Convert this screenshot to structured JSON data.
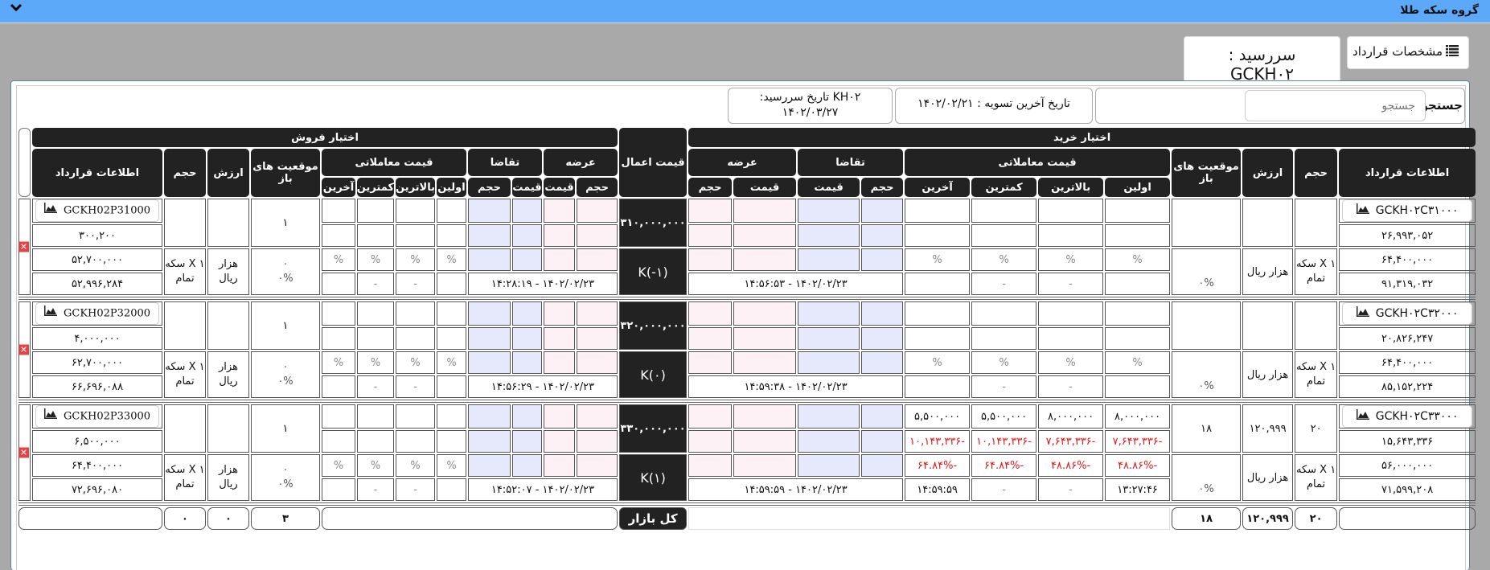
{
  "topbar": {
    "title": "گروه سکه طلا",
    "chevron_icon": "chevron-down-icon"
  },
  "tabs": {
    "spec_label": "مشخصات قرارداد",
    "spec_icon": "list-icon",
    "maturity_label": "سررسید : GCKH۰۲"
  },
  "info": {
    "search_label": "جستجو",
    "search_placeholder": "جستجو",
    "search_value": "",
    "last_settlement": "تاریخ آخرین تسویه : ۱۴۰۲/۰۲/۲۱",
    "maturity_line1": "KH۰۲ تاریخ سررسید:",
    "maturity_line2": "۱۴۰۲/۰۳/۲۷"
  },
  "headers": {
    "put_group": "اختیار فروش",
    "call_group": "اختیار خرید",
    "exercise_price": "قیمت اعمال",
    "contract_info": "اطلاعات قرارداد",
    "volume": "حجم",
    "value": "ارزش",
    "open_positions": "موقعیت های باز",
    "trade_price": "قیمت معاملاتی",
    "bid": "تقاضا",
    "ask": "عرضه",
    "first": "اولین",
    "high": "بالاترین",
    "low": "کمترین",
    "last": "آخرین",
    "qty": "حجم",
    "price": "قیمت",
    "total_market": "کل بازار"
  },
  "rows": [
    {
      "strike": "۳۱۰,۰۰۰,۰۰۰",
      "k": "K(-۱)",
      "put": {
        "symbol": "GCKH02P31000",
        "price1": "۳۰۰,۲۰۰",
        "price2": "۵۲,۷۰۰,۰۰۰",
        "price3": "۵۲,۹۹۶,۲۸۴",
        "unit": "X ۱ سکه تمام",
        "value_unit": "هزار ریال",
        "open_pos": "۱",
        "open_pos_change": "۰",
        "open_pos_pct": "۰%",
        "volume": "",
        "value": "",
        "trade": {
          "first": "",
          "high": "",
          "low": "",
          "last": ""
        },
        "trade_change": {
          "first": "",
          "high": "",
          "low": "",
          "last": ""
        },
        "trade_pct": {
          "first": "%",
          "high": "%",
          "low": "%",
          "last": "%"
        },
        "trade_time": {
          "first": "",
          "high": "-",
          "low": "-",
          "last": ""
        },
        "quote_time": "۱۴۰۲/۰۲/۲۳ - ۱۴:۲۸:۱۹"
      },
      "call": {
        "symbol": "GCKH۰۲C۳۱۰۰۰",
        "price1": "۲۶,۹۹۳,۰۵۲",
        "price2": "۶۴,۴۰۰,۰۰۰",
        "price3": "۹۱,۳۱۹,۰۳۲",
        "unit": "X ۱ سکه تمام",
        "value_unit": "هزار ریال",
        "open_pos": "",
        "open_pos_pct": "۰%",
        "volume": "",
        "value": "",
        "trade": {
          "first": "",
          "high": "",
          "low": "",
          "last": ""
        },
        "trade_change": {
          "first": "",
          "high": "",
          "low": "",
          "last": ""
        },
        "trade_pct": {
          "first": "%",
          "high": "%",
          "low": "%",
          "last": "%"
        },
        "trade_time": {
          "first": "",
          "high": "-",
          "low": "-",
          "last": ""
        },
        "quote_time": "۱۴۰۲/۰۲/۲۳ - ۱۴:۵۶:۵۳"
      }
    },
    {
      "strike": "۳۲۰,۰۰۰,۰۰۰",
      "k": "K(۰)",
      "put": {
        "symbol": "GCKH02P32000",
        "price1": "۴,۰۰۰,۰۰۰",
        "price2": "۶۲,۷۰۰,۰۰۰",
        "price3": "۶۶,۶۹۶,۰۸۸",
        "unit": "X ۱ سکه تمام",
        "value_unit": "هزار ریال",
        "open_pos": "۱",
        "open_pos_change": "۰",
        "open_pos_pct": "۰%",
        "volume": "",
        "value": "",
        "trade": {
          "first": "",
          "high": "",
          "low": "",
          "last": ""
        },
        "trade_change": {
          "first": "",
          "high": "",
          "low": "",
          "last": ""
        },
        "trade_pct": {
          "first": "%",
          "high": "%",
          "low": "%",
          "last": "%"
        },
        "trade_time": {
          "first": "",
          "high": "-",
          "low": "-",
          "last": ""
        },
        "quote_time": "۱۴۰۲/۰۲/۲۳ - ۱۴:۵۶:۲۹"
      },
      "call": {
        "symbol": "GCKH۰۲C۳۲۰۰۰",
        "price1": "۲۰,۸۲۶,۲۴۷",
        "price2": "۶۴,۴۰۰,۰۰۰",
        "price3": "۸۵,۱۵۲,۲۲۴",
        "unit": "X ۱ سکه تمام",
        "value_unit": "هزار ریال",
        "open_pos": "",
        "open_pos_pct": "۰%",
        "volume": "",
        "value": "",
        "trade": {
          "first": "",
          "high": "",
          "low": "",
          "last": ""
        },
        "trade_change": {
          "first": "",
          "high": "",
          "low": "",
          "last": ""
        },
        "trade_pct": {
          "first": "%",
          "high": "%",
          "low": "%",
          "last": "%"
        },
        "trade_time": {
          "first": "",
          "high": "-",
          "low": "-",
          "last": ""
        },
        "quote_time": "۱۴۰۲/۰۲/۲۳ - ۱۴:۵۹:۳۸"
      }
    },
    {
      "strike": "۳۳۰,۰۰۰,۰۰۰",
      "k": "K(۱)",
      "put": {
        "symbol": "GCKH02P33000",
        "price1": "۶,۵۰۰,۰۰۰",
        "price2": "۶۴,۴۰۰,۰۰۰",
        "price3": "۷۲,۶۹۶,۰۸۰",
        "unit": "X ۱ سکه تمام",
        "value_unit": "هزار ریال",
        "open_pos": "۱",
        "open_pos_change": "۰",
        "open_pos_pct": "۰%",
        "volume": "",
        "value": "",
        "trade": {
          "first": "",
          "high": "",
          "low": "",
          "last": ""
        },
        "trade_change": {
          "first": "",
          "high": "",
          "low": "",
          "last": ""
        },
        "trade_pct": {
          "first": "%",
          "high": "%",
          "low": "%",
          "last": "%"
        },
        "trade_time": {
          "first": "",
          "high": "-",
          "low": "-",
          "last": ""
        },
        "quote_time": "۱۴۰۲/۰۲/۲۳ - ۱۴:۵۲:۰۷"
      },
      "call": {
        "symbol": "GCKH۰۲C۳۳۰۰۰",
        "price1": "۱۵,۶۴۳,۳۳۶",
        "price2": "۵۶,۰۰۰,۰۰۰",
        "price3": "۷۱,۵۹۹,۲۰۸",
        "unit": "X ۱ سکه تمام",
        "value_unit": "هزار ریال",
        "open_pos": "۱۸",
        "open_pos_pct": "۰%",
        "volume": "۲۰",
        "value": "۱۲۰,۹۹۹",
        "trade": {
          "first": "۸,۰۰۰,۰۰۰",
          "high": "۸,۰۰۰,۰۰۰",
          "low": "۵,۵۰۰,۰۰۰",
          "last": "۵,۵۰۰,۰۰۰"
        },
        "trade_change": {
          "first": "-۷,۶۴۳,۳۳۶",
          "high": "-۷,۶۴۳,۳۳۶",
          "low": "-۱۰,۱۴۳,۳۳۶",
          "last": "-۱۰,۱۴۳,۳۳۶"
        },
        "trade_pct": {
          "first": "-۴۸.۸۶%",
          "high": "-۴۸.۸۶%",
          "low": "-۶۴.۸۴%",
          "last": "-۶۴.۸۴%"
        },
        "trade_time": {
          "first": "۱۳:۲۷:۴۶",
          "high": "-",
          "low": "-",
          "last": "۱۴:۵۹:۵۹"
        },
        "quote_time": "۱۴۰۲/۰۲/۲۳ - ۱۴:۵۹:۵۹"
      }
    }
  ],
  "totals": {
    "put_volume": "۰",
    "put_value": "۰",
    "put_open_pos": "۳",
    "call_open_pos": "۱۸",
    "call_value": "۱۲۰,۹۹۹",
    "call_volume": "۲۰"
  },
  "colors": {
    "topbar": "#5ca9f9",
    "header": "#222222",
    "negative": "#e01818",
    "bid_cell": "#e6e8fb",
    "ask_cell": "#fdf1f6"
  }
}
